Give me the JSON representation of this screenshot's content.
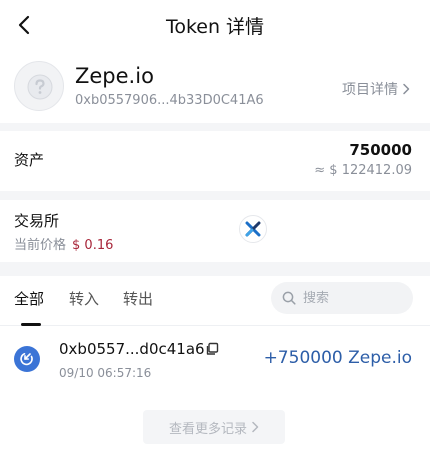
{
  "header": {
    "title": "Token 详情"
  },
  "token": {
    "name": "Zepe.io",
    "address": "0xb0557906...4b33D0C41A6",
    "project_detail_label": "项目详情"
  },
  "asset": {
    "label": "资产",
    "amount": "750000",
    "fiat_value": "≈ $ 122412.09"
  },
  "exchange": {
    "label": "交易所",
    "price_label": "当前价格",
    "price_value": "$ 0.16"
  },
  "tabs": {
    "all": "全部",
    "transfer_in": "转入",
    "transfer_out": "转出",
    "active": "全部"
  },
  "search": {
    "placeholder": "搜索"
  },
  "transactions": [
    {
      "address": "0xb0557...d0c41a6",
      "time": "09/10 06:57:16",
      "amount": "+750000 Zepe.io"
    }
  ],
  "more_button_label": "查看更多记录",
  "colors": {
    "accent_blue": "#3b74d6",
    "amount_blue": "#2d5ea8",
    "price_red": "#a8263a",
    "muted_gray": "#8a8f99"
  },
  "icons": {
    "back": "chevron-left-icon",
    "token_logo": "unknown-token-icon",
    "exchange_logo": "exchange-x-icon",
    "search": "search-icon",
    "tx_type": "transfer-in-icon",
    "copy": "copy-icon"
  }
}
